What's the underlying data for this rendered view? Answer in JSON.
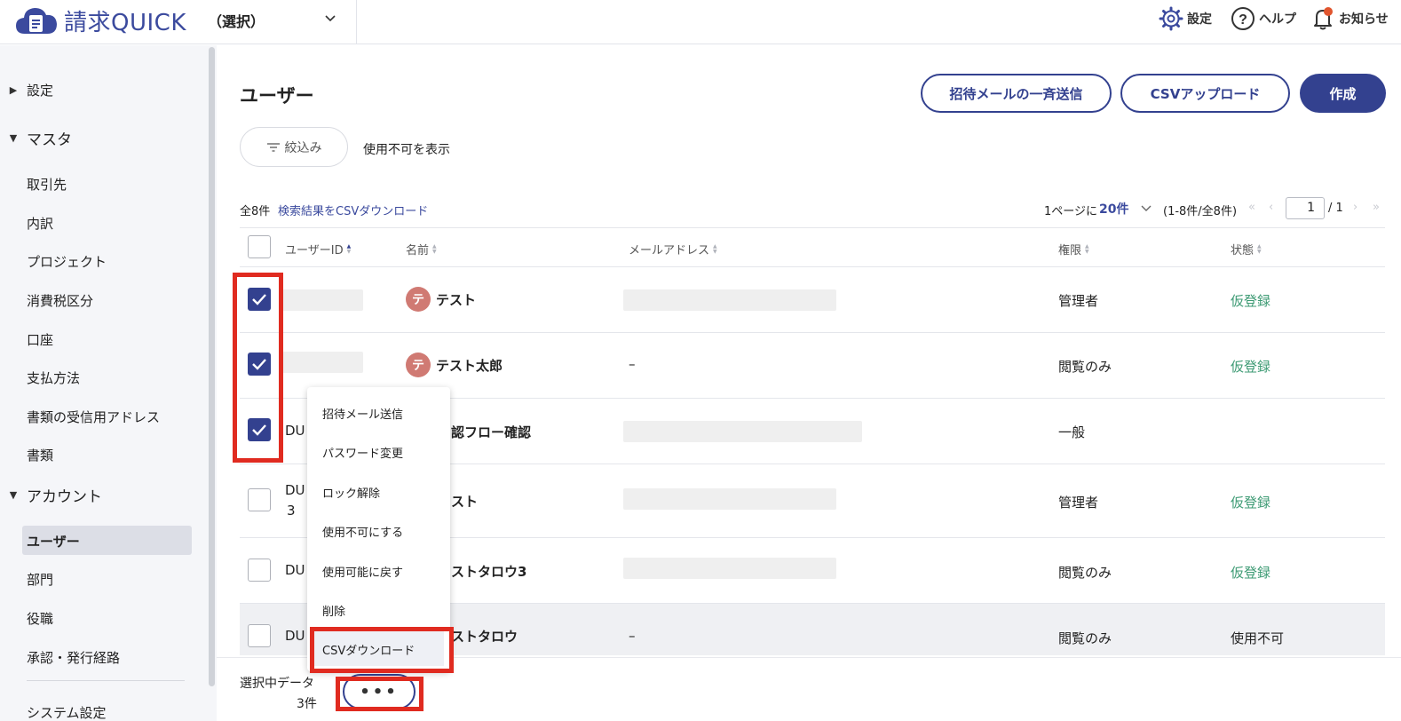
{
  "header": {
    "logo_text": "請求QUICK",
    "company": "（選択）",
    "settings": "設定",
    "help": "ヘルプ",
    "notice": "お知らせ"
  },
  "sidebar": {
    "g_settings": "設定",
    "g_master": "マスタ",
    "master_items": [
      "取引先",
      "内訳",
      "プロジェクト",
      "消費税区分",
      "口座",
      "支払方法",
      "書類の受信用アドレス",
      "書類"
    ],
    "g_account": "アカウント",
    "account_items": [
      "ユーザー",
      "部門",
      "役職",
      "承認・発行経路"
    ],
    "system": "システム設定"
  },
  "main": {
    "title": "ユーザー",
    "btn_invite": "招待メールの一斉送信",
    "btn_csv_upload": "CSVアップロード",
    "btn_create": "作成",
    "filter": "絞込み",
    "show_disabled": "使用不可を表示",
    "total": "全8件",
    "csv_download_link": "検索結果をCSVダウンロード",
    "per_page_label": "1ページに",
    "per_page_value": "20件",
    "range": "(1-8件/全8件)",
    "page_current": "1",
    "page_total": "/ 1"
  },
  "table": {
    "headers": [
      "ユーザーID",
      "名前",
      "メールアドレス",
      "権限",
      "状態"
    ],
    "rows": [
      {
        "id": "",
        "avatar": "テ",
        "name": "テスト",
        "email": "",
        "role": "管理者",
        "status": "仮登録",
        "checked": true
      },
      {
        "id": "",
        "avatar": "テ",
        "name": "テスト太郎",
        "email": "–",
        "role": "閲覧のみ",
        "status": "仮登録",
        "checked": true
      },
      {
        "id": "DU",
        "avatar": "",
        "name": "認フロー確認",
        "email": "",
        "role": "一般",
        "status": "",
        "checked": true
      },
      {
        "id": "DU",
        "id2": "3",
        "avatar": "",
        "name": "スト",
        "email": "",
        "role": "管理者",
        "status": "仮登録",
        "checked": false
      },
      {
        "id": "DU",
        "avatar": "",
        "name": "ストタロウ3",
        "email": "",
        "role": "閲覧のみ",
        "status": "仮登録",
        "checked": false
      },
      {
        "id": "DU",
        "avatar": "",
        "name": "ストタロウ",
        "email": "–",
        "role": "閲覧のみ",
        "status": "使用不可",
        "checked": false
      }
    ]
  },
  "menu": {
    "items": [
      "招待メール送信",
      "パスワード変更",
      "ロック解除",
      "使用不可にする",
      "使用可能に戻す",
      "削除",
      "CSVダウンロード"
    ]
  },
  "bottom": {
    "selected_label": "選択中データ",
    "selected_count": "3件",
    "more": "•••"
  },
  "colors": {
    "brand": "#33418f",
    "status_green": "#3c9a73",
    "highlight_red": "#e02b20"
  }
}
